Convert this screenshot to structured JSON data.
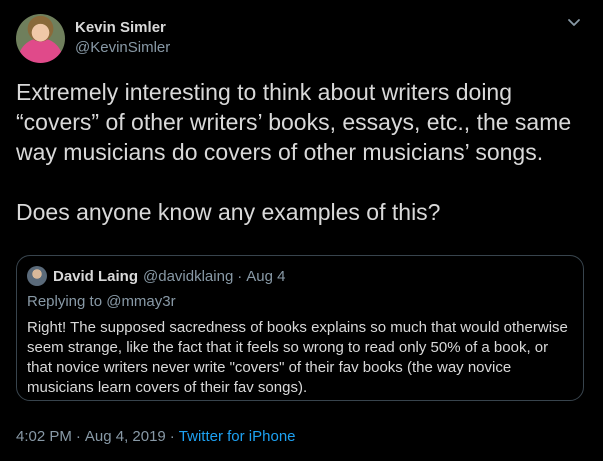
{
  "author": {
    "name": "Kevin Simler",
    "handle": "@KevinSimler"
  },
  "tweet": {
    "text": "Extremely interesting to think about writers doing “covers” of other writers’ books, essays, etc., the same way musicians do covers of other musicians’ songs.\n\nDoes anyone know any examples of this?"
  },
  "quote": {
    "name": "David Laing",
    "handle": "@davidklaing",
    "separator": "·",
    "date": "Aug 4",
    "replying_to": "Replying to @mmay3r",
    "text": "Right! The supposed sacredness of books explains so much that would otherwise\nseem strange, like the fact that it feels so wrong to read only 50% of a book, or\nthat novice writers never write \"covers\" of their fav books (the way novice\nmusicians learn covers of their fav songs)."
  },
  "footer": {
    "time": "4:02 PM",
    "sep1": "·",
    "date": "Aug 4, 2019",
    "sep2": "·",
    "source": "Twitter for iPhone"
  },
  "icons": {
    "menu": "chevron-down-icon"
  },
  "colors": {
    "background": "#000000",
    "text": "#d9d9d9",
    "muted": "#8899a6",
    "link": "#1da1f2",
    "border": "#38444d"
  }
}
